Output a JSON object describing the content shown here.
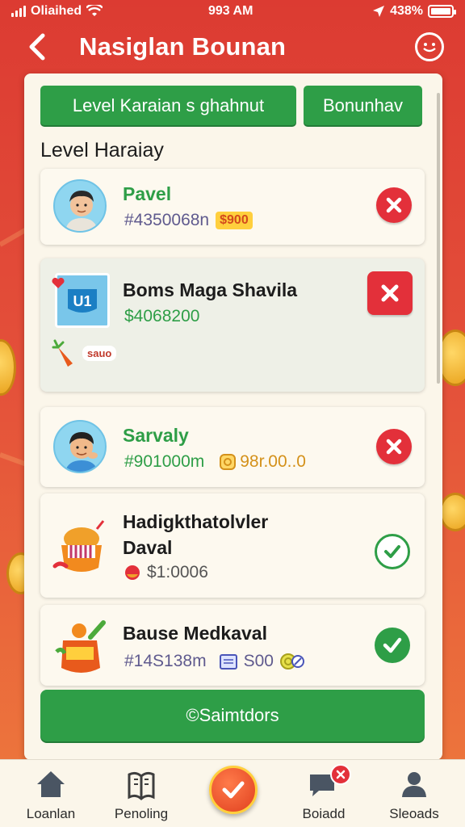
{
  "status_bar": {
    "carrier": "Oliaihed",
    "time": "993 AM",
    "battery": "438%"
  },
  "header": {
    "title": "Nasiglan Bounan",
    "back_icon": "chevron-left-icon",
    "menu_icon": "smiley-menu-icon"
  },
  "tabs": [
    {
      "label": "Level Karaian s ghahnut"
    },
    {
      "label": "Bonunhav"
    }
  ],
  "section_title": "Level Haraiay",
  "items": [
    {
      "name": "Pavel",
      "detail": "#4350068n",
      "badge": "$900",
      "action": "reject"
    },
    {
      "name": "Boms Maga Shavila",
      "detail": "$4068200",
      "tag": "sauo",
      "action": "reject"
    },
    {
      "name": "Sarvaly",
      "detail": "#901000m",
      "extra": "98r.00..0",
      "action": "reject"
    },
    {
      "name": "Hadigkthatolvler",
      "name2": "Daval",
      "detail": "$1:0006",
      "action": "approve-outline"
    },
    {
      "name": "Bause Medkaval",
      "detail": "#14S138m",
      "extra": "S00",
      "action": "approve"
    }
  ],
  "cta": {
    "label": "©Saimtdors"
  },
  "nav": [
    {
      "label": "Loanlan",
      "icon": "home-icon"
    },
    {
      "label": "Penoling",
      "icon": "book-icon"
    },
    {
      "label": "",
      "icon": "check-circle-icon"
    },
    {
      "label": "Boiadd",
      "icon": "chat-icon"
    },
    {
      "label": "Sleoads",
      "icon": "user-icon"
    }
  ],
  "colors": {
    "brand_red": "#d63a30",
    "accent_green": "#2e9e47",
    "panel": "#fbf6ea"
  }
}
